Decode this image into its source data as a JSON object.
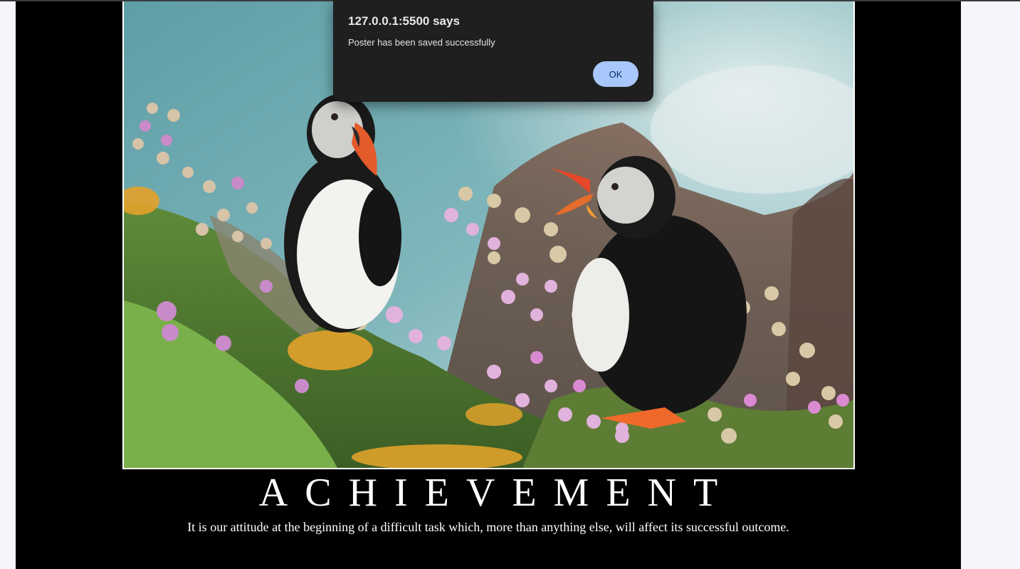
{
  "poster": {
    "image_subject": "Two Atlantic puffins standing among pink sea thrift flowers on a mossy cliff above the sea",
    "title": "ACHIEVEMENT",
    "subtitle": "It is our attitude at the beginning of a difficult task which, more than anything else, will affect its successful outcome."
  },
  "dialog": {
    "title": "127.0.0.1:5500 says",
    "message": "Poster has been saved successfully",
    "ok_label": "OK"
  },
  "colors": {
    "page_background": "#f5f5fc",
    "poster_background": "#000000",
    "dialog_background": "#1f1f1f",
    "ok_button": "#a8c7fa"
  }
}
